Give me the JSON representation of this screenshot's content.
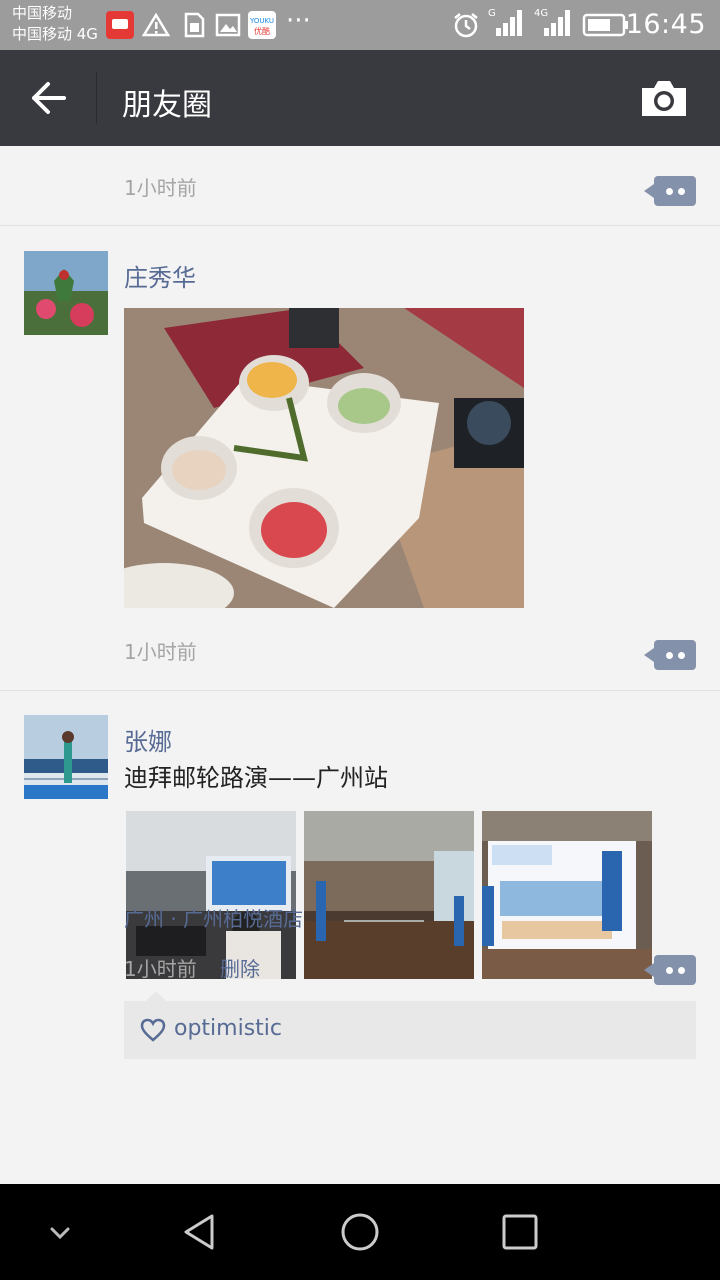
{
  "status_bar": {
    "carrier_line1": "中国移动",
    "carrier_line2": "中国移动 4G",
    "time": "16:45",
    "more": "···",
    "signal1_label": "G",
    "signal2_label": "4G",
    "app_icon_label": "YOUKU",
    "app_icon_sublabel": "优酷",
    "icons": [
      "app-notification-icon",
      "warning-icon",
      "sim-icon",
      "image-icon",
      "youku-icon",
      "alarm-icon",
      "signal-icon",
      "battery-icon"
    ]
  },
  "app_bar": {
    "title": "朋友圈",
    "back_icon": "arrow-left-icon",
    "camera_icon": "camera-icon"
  },
  "feed": {
    "posts": [
      {
        "time": "1小时前",
        "comment_icon": "comment-icon"
      },
      {
        "username": "庄秀华",
        "photo": "dessert-cups-photo",
        "time": "1小时前",
        "comment_icon": "comment-icon"
      },
      {
        "username": "张娜",
        "text": "迪拜邮轮路演——广州站",
        "photos": [
          "presentation-room-photo",
          "hotel-lobby-photo",
          "exhibition-banner-photo"
        ],
        "location": "广州 · 广州柏悦酒店",
        "time": "1小时前",
        "delete_label": "删除",
        "likes": [
          "optimistic"
        ],
        "like_icon": "heart-icon"
      }
    ]
  },
  "nav_bar": {
    "icons": [
      "chevron-down-icon",
      "back-triangle-icon",
      "home-circle-icon",
      "recents-square-icon"
    ]
  },
  "colors": {
    "app_bar": "#393a3f",
    "link": "#576b95",
    "background": "#f3f3f3",
    "status_bar": "#9c9c9c"
  }
}
